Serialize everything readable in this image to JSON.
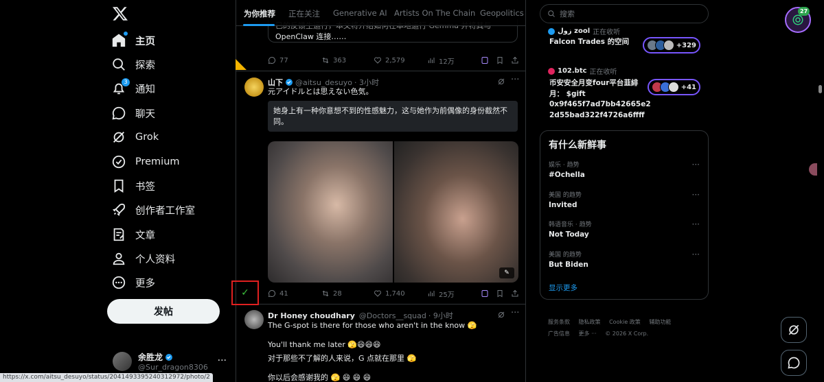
{
  "status_url": "https://x.com/aitsu_desuyo/status/2041493395240312972/photo/2",
  "nav": {
    "items": [
      {
        "label": "主页",
        "icon": "home-icon"
      },
      {
        "label": "探索",
        "icon": "search-icon"
      },
      {
        "label": "通知",
        "icon": "bell-icon",
        "badge": "3"
      },
      {
        "label": "聊天",
        "icon": "chat-icon"
      },
      {
        "label": "Grok",
        "icon": "grok-icon"
      },
      {
        "label": "Premium",
        "icon": "premium-icon"
      },
      {
        "label": "书签",
        "icon": "bookmark-icon"
      },
      {
        "label": "创作者工作室",
        "icon": "rocket-icon"
      },
      {
        "label": "文章",
        "icon": "article-icon"
      },
      {
        "label": "个人资料",
        "icon": "profile-icon"
      },
      {
        "label": "更多",
        "icon": "more-icon"
      }
    ],
    "post_button": "发帖",
    "account": {
      "name": "余胜龙",
      "handle": "@Sur_dragon8306"
    }
  },
  "tabs": [
    "为你推荐",
    "正在关注",
    "Generative AI",
    "Artists On The Chain",
    "Geopolitics"
  ],
  "feed": {
    "prev_quote_line1": "已的反馈生运行，本文将介绍如何在本地运行 Gemma 并将其与",
    "prev_quote_line2": "OpenClaw 连接……",
    "prev_actions": {
      "replies": "77",
      "reposts": "363",
      "likes": "2,579",
      "views": "12万"
    },
    "tweet1": {
      "name": "山下",
      "handle": "@aitsu_desuyo",
      "time": "· 3小时",
      "text": "元アイドルとは思えない色気。",
      "translation": "她身上有一种你意想不到的性感魅力，这与她作为前偶像的身份截然不同。",
      "alt_badge": "✎",
      "actions": {
        "replies": "41",
        "reposts": "28",
        "likes": "1,740",
        "views": "25万"
      }
    },
    "tweet2": {
      "name": "Dr Honey choudhary",
      "handle": "@Doctors__squad",
      "time": "· 9小时",
      "line1": "The G-spot is there for those who aren't in the know 🫣",
      "line2": "You'll thank me later 🫣😄😄😄",
      "line3": "对于那些不了解的人来说，G 点就在那里 🫣",
      "line4": "你以后会感谢我的 🫣 😄 😄 😄"
    },
    "check_mark": "✓"
  },
  "right": {
    "search_placeholder": "搜索",
    "spaces": [
      {
        "host": "زول zool",
        "status": "正在收听",
        "title": "Falcon Trades 的空间",
        "count": "+329"
      },
      {
        "host": "102.btc",
        "status": "正在收听",
        "title_lines": [
          "币安安全月变four平台韮緋",
          "月： $gift",
          "0x9f465f7ad7bb42665e2",
          "2d55bad322f4726a6ffff"
        ],
        "count": "+41"
      }
    ],
    "trends_title": "有什么新鲜事",
    "trends": [
      {
        "category": "娱乐 · 趋势",
        "name": "#Ochella"
      },
      {
        "category": "美国 的趋势",
        "name": "Invited"
      },
      {
        "category": "韩语音乐 · 趋势",
        "name": "Not Today"
      },
      {
        "category": "美国 的趋势",
        "name": "But Biden"
      }
    ],
    "show_more": "显示更多",
    "footer_row1": [
      "服务条款",
      "隐私政策",
      "Cookie 政策",
      "辅助功能"
    ],
    "footer_row2": [
      "广告信息",
      "更多 ···",
      "© 2026 X Corp."
    ]
  },
  "extension_badge": "27",
  "colors": {
    "accent": "#1d9bf0",
    "background": "#000000",
    "border": "#2f3336",
    "space_purple": "#7856ff"
  }
}
